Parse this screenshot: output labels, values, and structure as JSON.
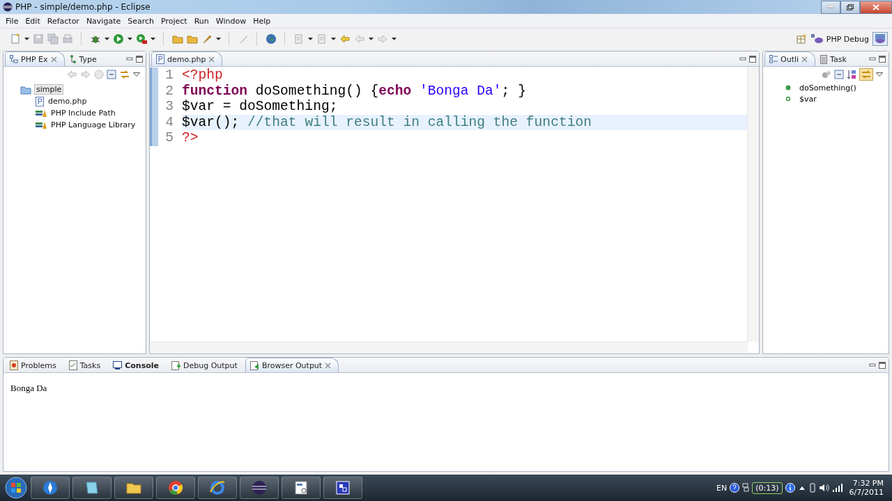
{
  "window": {
    "title": "PHP - simple/demo.php - Eclipse"
  },
  "menu": [
    "File",
    "Edit",
    "Refactor",
    "Navigate",
    "Search",
    "Project",
    "Run",
    "Window",
    "Help"
  ],
  "perspective": {
    "label": "PHP Debug"
  },
  "explorer": {
    "tabs": [
      {
        "label": "PHP Ex",
        "selected": true
      },
      {
        "label": "Type",
        "selected": false
      }
    ],
    "tree": [
      {
        "label": "simple",
        "kind": "project",
        "selected": true,
        "children": [
          {
            "label": "demo.php",
            "kind": "file",
            "selected": false
          },
          {
            "label": "PHP Include Path",
            "kind": "library",
            "selected": false
          },
          {
            "label": "PHP Language Library",
            "kind": "library",
            "selected": false
          }
        ]
      }
    ]
  },
  "editor": {
    "tabs": [
      {
        "label": "demo.php",
        "selected": true
      }
    ],
    "lines": [
      {
        "number": "1",
        "current": false,
        "tokens": [
          {
            "kind": "tag",
            "text": "<?php"
          }
        ]
      },
      {
        "number": "2",
        "current": false,
        "tokens": [
          {
            "kind": "keyword",
            "text": "function"
          },
          {
            "kind": "plain",
            "text": " doSomething() {"
          },
          {
            "kind": "keyword",
            "text": "echo "
          },
          {
            "kind": "string",
            "text": "'Bonga Da'"
          },
          {
            "kind": "plain",
            "text": "; }"
          }
        ]
      },
      {
        "number": "3",
        "current": false,
        "tokens": [
          {
            "kind": "plain",
            "text": "$var = doSomething;"
          }
        ]
      },
      {
        "number": "4",
        "current": true,
        "tokens": [
          {
            "kind": "plain",
            "text": "$var(); "
          },
          {
            "kind": "comment",
            "text": "//that will result in calling the function"
          }
        ]
      },
      {
        "number": "5",
        "current": false,
        "tokens": [
          {
            "kind": "tag",
            "text": "?>"
          }
        ]
      }
    ]
  },
  "outline": {
    "tabs": [
      {
        "label": "Outli",
        "selected": true
      },
      {
        "label": "Task",
        "selected": false
      }
    ],
    "items": [
      {
        "label": "doSomething()",
        "kind": "function"
      },
      {
        "label": "$var",
        "kind": "variable"
      }
    ]
  },
  "console": {
    "tabs": [
      {
        "label": "Problems",
        "selected": false,
        "bold": false
      },
      {
        "label": "Tasks",
        "selected": false,
        "bold": false
      },
      {
        "label": "Console",
        "selected": false,
        "bold": true
      },
      {
        "label": "Debug Output",
        "selected": false,
        "bold": false
      },
      {
        "label": "Browser Output",
        "selected": true,
        "bold": false
      }
    ],
    "output": "Bonga Da"
  },
  "taskbar": {
    "language": "EN",
    "timer": "(0:13)",
    "time": "7:32 PM",
    "date": "6/7/2011"
  }
}
